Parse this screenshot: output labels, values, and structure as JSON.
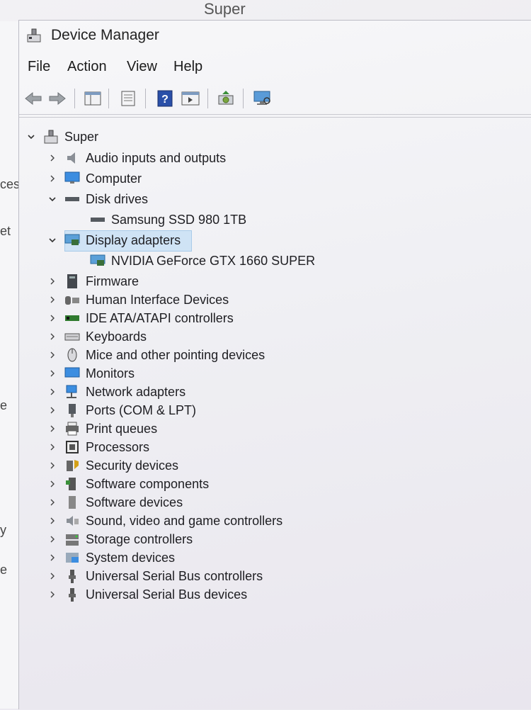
{
  "background_window": {
    "title": "Super",
    "left_fragments": [
      "ces",
      "et",
      "e",
      "y",
      "e"
    ]
  },
  "window": {
    "title": "Device Manager"
  },
  "menu": [
    "File",
    "Action",
    "View",
    "Help"
  ],
  "toolbar": {
    "buttons": [
      "back-arrow-icon",
      "forward-arrow-icon",
      "show-hide-tree-icon",
      "properties-icon",
      "help-icon",
      "run-view-icon",
      "update-driver-icon",
      "scan-hardware-icon"
    ]
  },
  "tree": {
    "root": "Super",
    "items": [
      {
        "label": "Audio inputs and outputs",
        "expanded": false
      },
      {
        "label": "Computer",
        "expanded": false
      },
      {
        "label": "Disk drives",
        "expanded": true,
        "children": [
          "Samsung SSD 980 1TB"
        ]
      },
      {
        "label": "Display adapters",
        "expanded": true,
        "selected": true,
        "children": [
          "NVIDIA GeForce GTX 1660 SUPER"
        ]
      },
      {
        "label": "Firmware",
        "expanded": false
      },
      {
        "label": "Human Interface Devices",
        "expanded": false
      },
      {
        "label": "IDE ATA/ATAPI controllers",
        "expanded": false
      },
      {
        "label": "Keyboards",
        "expanded": false
      },
      {
        "label": "Mice and other pointing devices",
        "expanded": false
      },
      {
        "label": "Monitors",
        "expanded": false
      },
      {
        "label": "Network adapters",
        "expanded": false
      },
      {
        "label": "Ports (COM & LPT)",
        "expanded": false
      },
      {
        "label": "Print queues",
        "expanded": false
      },
      {
        "label": "Processors",
        "expanded": false
      },
      {
        "label": "Security devices",
        "expanded": false
      },
      {
        "label": "Software components",
        "expanded": false
      },
      {
        "label": "Software devices",
        "expanded": false
      },
      {
        "label": "Sound, video and game controllers",
        "expanded": false
      },
      {
        "label": "Storage controllers",
        "expanded": false
      },
      {
        "label": "System devices",
        "expanded": false
      },
      {
        "label": "Universal Serial Bus controllers",
        "expanded": false
      },
      {
        "label": "Universal Serial Bus devices",
        "expanded": false
      }
    ]
  },
  "colors": {
    "selection": "#cfe3f5",
    "accent_blue": "#2a6fc0"
  }
}
